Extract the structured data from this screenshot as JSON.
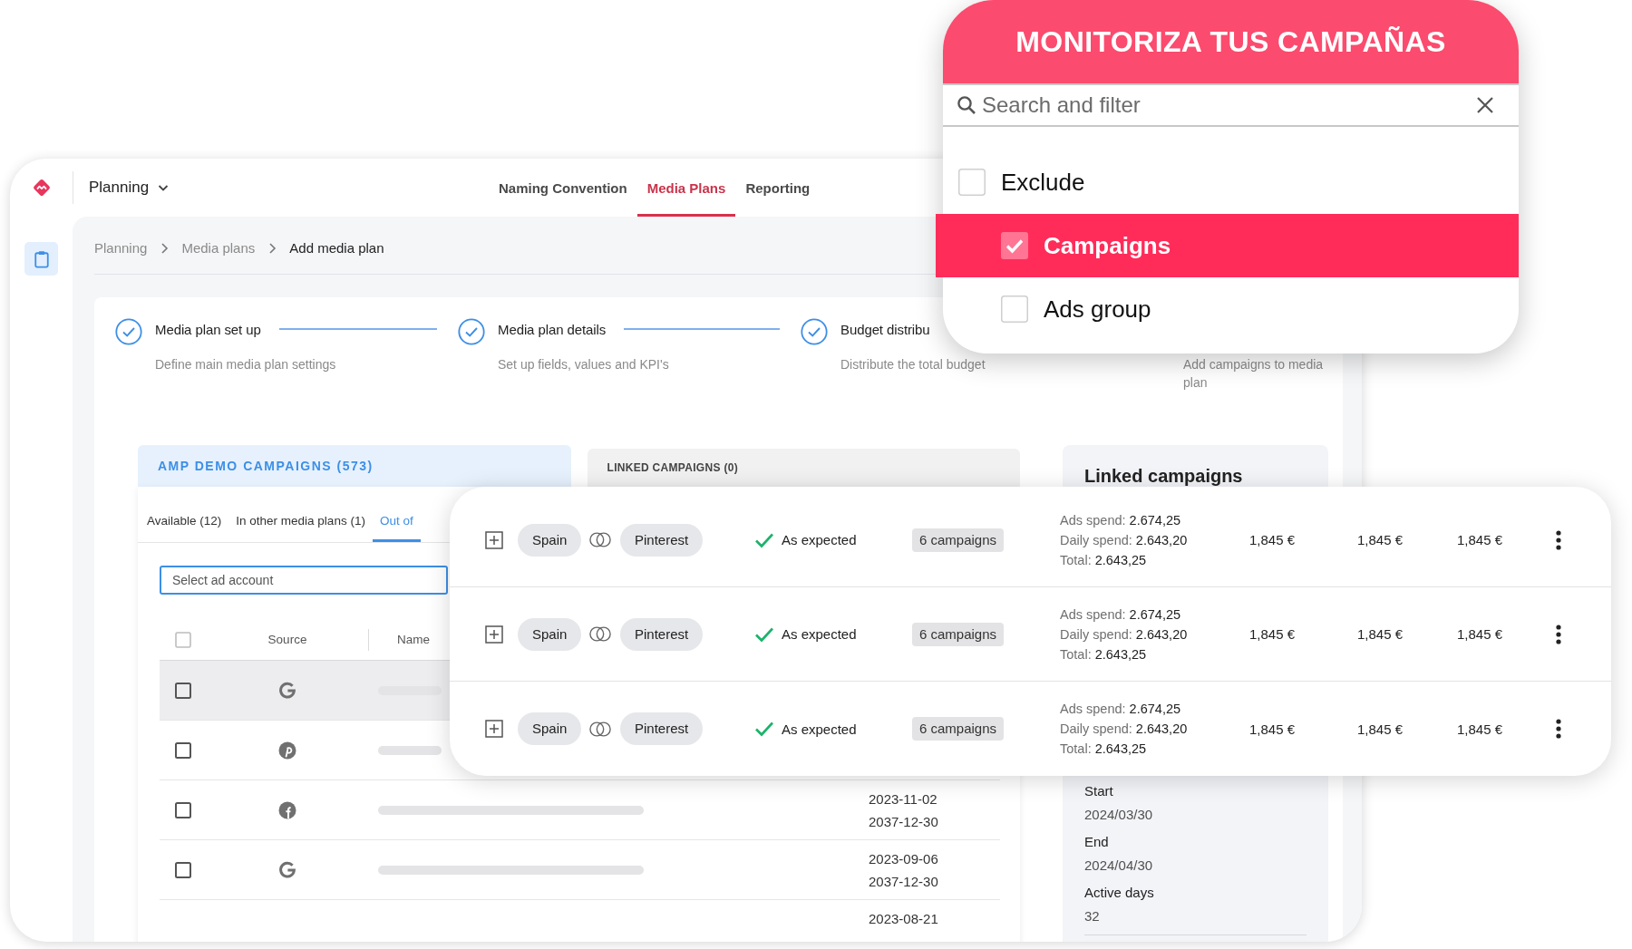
{
  "app": {
    "module": "Planning",
    "nav_tabs": [
      {
        "label": "Naming Convention",
        "selected": false
      },
      {
        "label": "Media Plans",
        "selected": true
      },
      {
        "label": "Reporting",
        "selected": false
      }
    ],
    "sidebar": [
      {
        "selected": true
      }
    ]
  },
  "breadcrumb": [
    "Planning",
    "Media plans",
    "Add media plan"
  ],
  "steps": [
    {
      "title": "Media plan set up",
      "subtitle": "Define main media plan settings",
      "done": true
    },
    {
      "title": "Media plan details",
      "subtitle": "Set up fields, values and KPI's",
      "done": true
    },
    {
      "title": "Budget distribu",
      "subtitle": "Distribute the total budget",
      "done": true
    },
    {
      "subtitle": "Add campaigns to media plan"
    }
  ],
  "campaigns_panel": {
    "tabs": [
      {
        "label": "AMP DEMO CAMPAIGNS (573)",
        "selected": true
      },
      {
        "label": "LINKED CAMPAIGNS (0)",
        "selected": false
      }
    ],
    "filter_tabs": [
      {
        "label": "Available (12)",
        "selected": false
      },
      {
        "label": "In other media plans (1)",
        "selected": false
      },
      {
        "label": "Out of",
        "selected": true
      }
    ],
    "account_field": {
      "placeholder": "Select ad account"
    },
    "table": {
      "select_all": {
        "checked": false
      },
      "columns": [
        "Source",
        "Name"
      ],
      "rows": [
        {
          "kind": "google",
          "checked": false,
          "highlighted": true
        },
        {
          "kind": "pinterest",
          "checked": false,
          "highlighted": false
        },
        {
          "kind": "facebook",
          "checked": false,
          "highlighted": false,
          "dates": [
            "2023-11-02",
            "2037-12-30"
          ]
        },
        {
          "kind": "google",
          "checked": false,
          "highlighted": false,
          "dates": [
            "2023-09-06",
            "2037-12-30"
          ]
        },
        {
          "highlighted": false,
          "dates": [
            "2023-08-21"
          ]
        }
      ]
    }
  },
  "linked_summary": {
    "title": "Linked campaigns",
    "fields": [
      {
        "label": "Start",
        "value": "2024/03/30"
      },
      {
        "label": "End",
        "value": "2024/04/30"
      },
      {
        "label": "Active days",
        "value": "32"
      }
    ]
  },
  "campaign_rows": [
    {
      "country": "Spain",
      "platform": "Pinterest",
      "status": {
        "text": "As expected",
        "ok": true
      },
      "count": "6 campaigns",
      "stats": [
        {
          "label": "Ads spend:",
          "value": "2.674,25"
        },
        {
          "label": "Daily spend:",
          "value": "2.643,20"
        },
        {
          "label": "Total:",
          "value": "2.643,25"
        }
      ],
      "amounts": [
        "1,845 €",
        "1,845 €",
        "1,845 €"
      ]
    },
    {
      "country": "Spain",
      "platform": "Pinterest",
      "status": {
        "text": "As expected",
        "ok": true
      },
      "count": "6 campaigns",
      "stats": [
        {
          "label": "Ads spend:",
          "value": "2.674,25"
        },
        {
          "label": "Daily spend:",
          "value": "2.643,20"
        },
        {
          "label": "Total:",
          "value": "2.643,25"
        }
      ],
      "amounts": [
        "1,845 €",
        "1,845 €",
        "1,845 €"
      ]
    },
    {
      "country": "Spain",
      "platform": "Pinterest",
      "status": {
        "text": "As expected",
        "ok": true
      },
      "count": "6 campaigns",
      "stats": [
        {
          "label": "Ads spend:",
          "value": "2.674,25"
        },
        {
          "label": "Daily spend:",
          "value": "2.643,20"
        },
        {
          "label": "Total:",
          "value": "2.643,25"
        }
      ],
      "amounts": [
        "1,845 €",
        "1,845 €",
        "1,845 €"
      ]
    }
  ],
  "filter_popup": {
    "title": "MONITORIZA TUS CAMPAÑAS",
    "search": {
      "placeholder": "Search and filter"
    },
    "options": [
      {
        "label": "Exclude",
        "checked": false,
        "selected": false,
        "children": [
          {
            "label": "Campaigns",
            "checked": true,
            "selected": true
          },
          {
            "label": "Ads group",
            "checked": false,
            "selected": false
          }
        ]
      }
    ]
  }
}
